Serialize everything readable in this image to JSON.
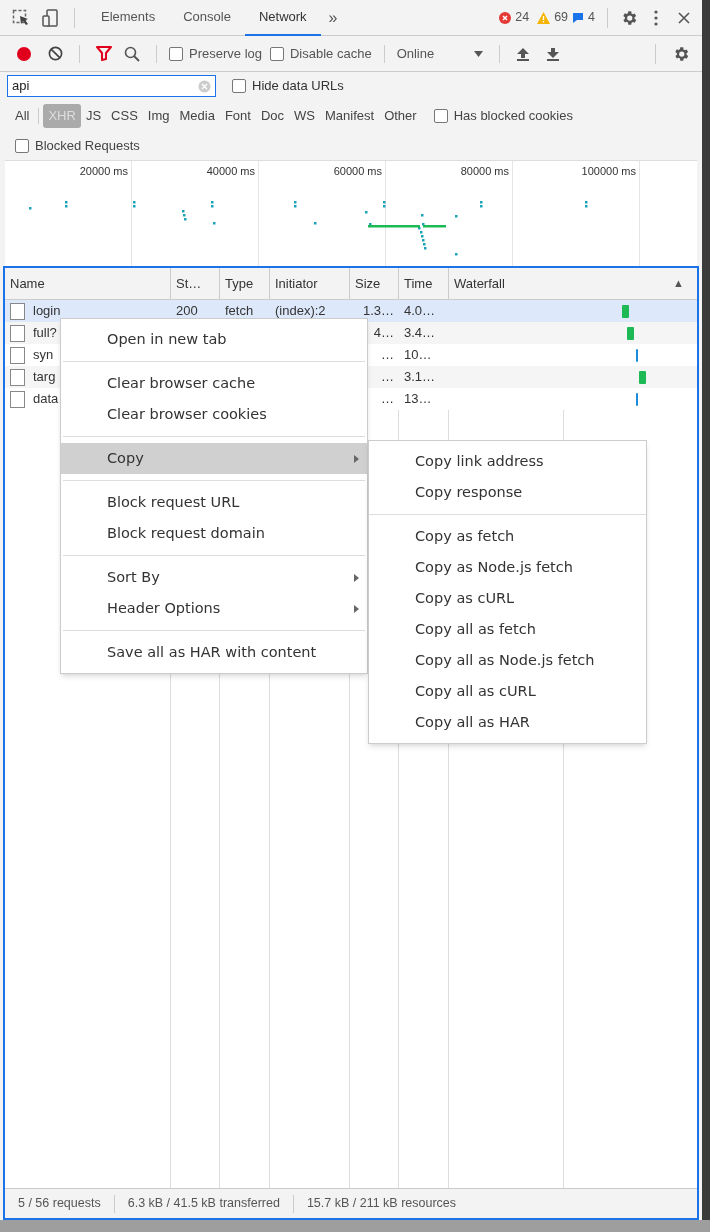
{
  "tabs": [
    {
      "label": "Elements",
      "selected": false
    },
    {
      "label": "Console",
      "selected": false
    },
    {
      "label": "Network",
      "selected": true
    }
  ],
  "more_tabs": "»",
  "counts": {
    "errors": "24",
    "warnings": "69",
    "messages": "4"
  },
  "toolbar": {
    "recording": true,
    "preserve_log": {
      "label": "Preserve log",
      "checked": false
    },
    "disable_cache": {
      "label": "Disable cache",
      "checked": false
    },
    "throttling": "Online"
  },
  "filter": {
    "value": "api",
    "hide_data_urls": {
      "label": "Hide data URLs",
      "checked": false
    }
  },
  "type_filters": [
    {
      "label": "All",
      "selected": false
    },
    {
      "label": "XHR",
      "selected": true
    },
    {
      "label": "JS",
      "selected": false
    },
    {
      "label": "CSS",
      "selected": false
    },
    {
      "label": "Img",
      "selected": false
    },
    {
      "label": "Media",
      "selected": false
    },
    {
      "label": "Font",
      "selected": false
    },
    {
      "label": "Doc",
      "selected": false
    },
    {
      "label": "WS",
      "selected": false
    },
    {
      "label": "Manifest",
      "selected": false
    },
    {
      "label": "Other",
      "selected": false
    }
  ],
  "has_blocked_cookies": {
    "label": "Has blocked cookies",
    "checked": false
  },
  "blocked_requests": {
    "label": "Blocked Requests",
    "checked": false
  },
  "overview_ticks": [
    "20000 ms",
    "40000 ms",
    "60000 ms",
    "80000 ms",
    "100000 ms"
  ],
  "table": {
    "columns": [
      "Name",
      "St…",
      "Type",
      "Initiator",
      "Size",
      "Time",
      "Waterfall"
    ],
    "sort_indicator": "▲",
    "rows": [
      {
        "name": "login",
        "status": "200",
        "type": "fetch",
        "initiator": "(index):2",
        "size": "1.3…",
        "time": "4.0…",
        "selected": true,
        "color": "#1db954"
      },
      {
        "name": "full?",
        "size": "4…",
        "time": "3.4…",
        "selected": false,
        "color": "#1db954"
      },
      {
        "name": "syn",
        "size": "…",
        "time": "10…",
        "selected": false,
        "color": "#1a8cd8"
      },
      {
        "name": "targ",
        "size": "…",
        "time": "3.1…",
        "selected": false,
        "color": "#1db954"
      },
      {
        "name": "data",
        "size": "…",
        "time": "13…",
        "selected": false,
        "color": "#1a8cd8"
      }
    ]
  },
  "context_menu": {
    "groups": [
      [
        {
          "label": "Open in new tab",
          "selected": false,
          "submenu": false
        }
      ],
      [
        {
          "label": "Clear browser cache",
          "selected": false,
          "submenu": false
        },
        {
          "label": "Clear browser cookies",
          "selected": false,
          "submenu": false
        }
      ],
      [
        {
          "label": "Copy",
          "selected": true,
          "submenu": true
        }
      ],
      [
        {
          "label": "Block request URL",
          "selected": false,
          "submenu": false
        },
        {
          "label": "Block request domain",
          "selected": false,
          "submenu": false
        }
      ],
      [
        {
          "label": "Sort By",
          "selected": false,
          "submenu": true
        },
        {
          "label": "Header Options",
          "selected": false,
          "submenu": true
        }
      ],
      [
        {
          "label": "Save all as HAR with content",
          "selected": false,
          "submenu": false
        }
      ]
    ],
    "submenu": [
      [
        "Copy link address",
        "Copy response"
      ],
      [
        "Copy as fetch",
        "Copy as Node.js fetch",
        "Copy as cURL",
        "Copy all as fetch",
        "Copy all as Node.js fetch",
        "Copy all as cURL",
        "Copy all as HAR"
      ]
    ]
  },
  "status_bar": [
    "5 / 56 requests",
    "6.3 kB / 41.5 kB transferred",
    "15.7 kB / 211 kB resources"
  ]
}
